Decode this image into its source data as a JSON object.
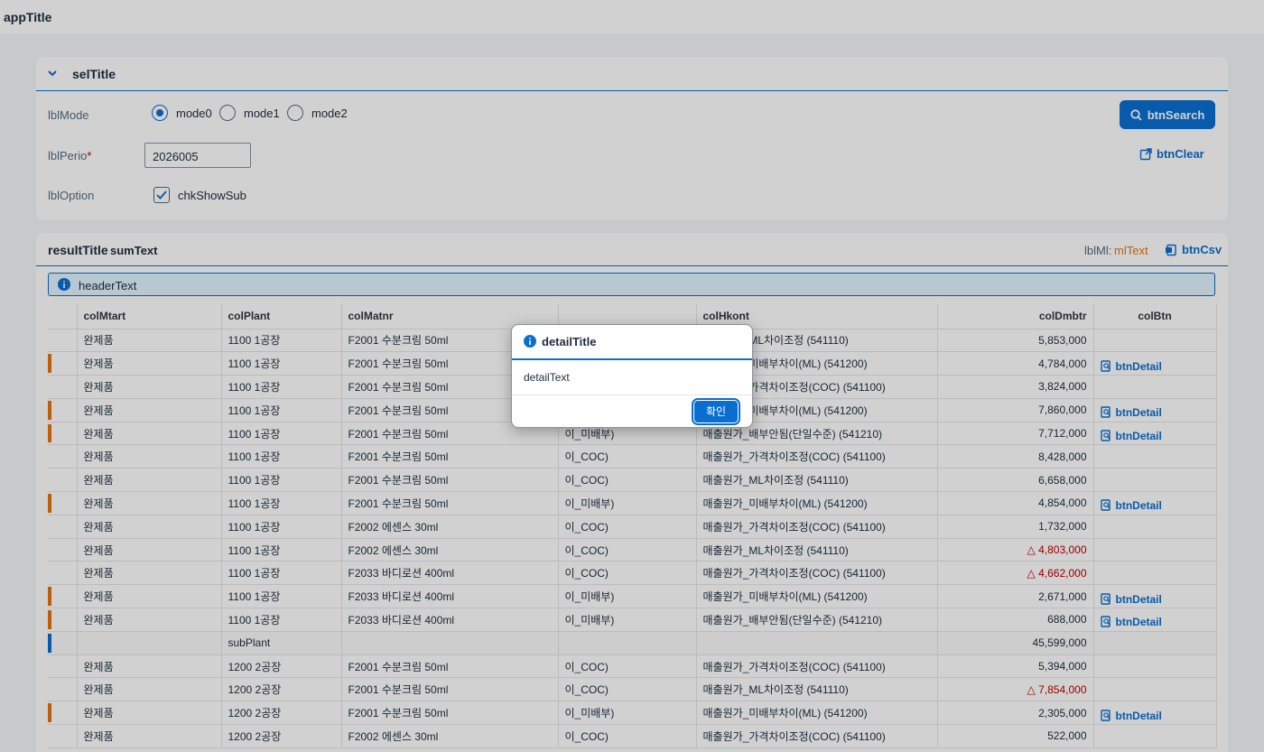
{
  "app": {
    "title": "appTitle"
  },
  "selection": {
    "title": "selTitle",
    "mode_label": "lblMode",
    "modes": [
      "mode0",
      "mode1",
      "mode2"
    ],
    "selected_mode": "mode0",
    "perio_label": "lblPerio",
    "perio_required": "*",
    "perio_value": "2026005",
    "option_label": "lblOption",
    "checkbox_label": "chkShowSub",
    "checkbox_checked": true,
    "search_label": "btnSearch",
    "clear_label": "btnClear"
  },
  "results": {
    "title": "resultTitle",
    "sum_text": "sumText",
    "ml_label": "lblMl:",
    "ml_text": "mlText",
    "csv_label": "btnCsv",
    "header_text": "headerText",
    "columns": [
      "",
      "colMtart",
      "colPlant",
      "colMatnr",
      "",
      "colHkont",
      "colDmbtr",
      "colBtn"
    ],
    "rows": [
      {
        "indicator": "",
        "mtart": "완제품",
        "plant": "1100 1공장",
        "matnr": "F2001 수분크림 50ml",
        "diff": "",
        "hkont": "매출원가_ML차이조정 (541110)",
        "dmbtr": "5,853,000",
        "neg": false,
        "btn": ""
      },
      {
        "indicator": "#e9730c",
        "mtart": "완제품",
        "plant": "1100 1공장",
        "matnr": "F2001 수분크림 50ml",
        "diff": "",
        "hkont": "매출원가_미배부차이(ML) (541200)",
        "dmbtr": "4,784,000",
        "neg": false,
        "btn": "btnDetail"
      },
      {
        "indicator": "",
        "mtart": "완제품",
        "plant": "1100 1공장",
        "matnr": "F2001 수분크림 50ml",
        "diff": "",
        "hkont": "매출원가_가격차이조정(COC) (541100)",
        "dmbtr": "3,824,000",
        "neg": false,
        "btn": ""
      },
      {
        "indicator": "#e9730c",
        "mtart": "완제품",
        "plant": "1100 1공장",
        "matnr": "F2001 수분크림 50ml",
        "diff": "",
        "hkont": "매출원가_미배부차이(ML) (541200)",
        "dmbtr": "7,860,000",
        "neg": false,
        "btn": "btnDetail"
      },
      {
        "indicator": "#e9730c",
        "mtart": "완제품",
        "plant": "1100 1공장",
        "matnr": "F2001 수분크림 50ml",
        "diff": "이_미배부)",
        "hkont": "매출원가_배부안됨(단일수준) (541210)",
        "dmbtr": "7,712,000",
        "neg": false,
        "btn": "btnDetail"
      },
      {
        "indicator": "",
        "mtart": "완제품",
        "plant": "1100 1공장",
        "matnr": "F2001 수분크림 50ml",
        "diff": "이_COC)",
        "hkont": "매출원가_가격차이조정(COC) (541100)",
        "dmbtr": "8,428,000",
        "neg": false,
        "btn": ""
      },
      {
        "indicator": "",
        "mtart": "완제품",
        "plant": "1100 1공장",
        "matnr": "F2001 수분크림 50ml",
        "diff": "이_COC)",
        "hkont": "매출원가_ML차이조정 (541110)",
        "dmbtr": "6,658,000",
        "neg": false,
        "btn": ""
      },
      {
        "indicator": "#e9730c",
        "mtart": "완제품",
        "plant": "1100 1공장",
        "matnr": "F2001 수분크림 50ml",
        "diff": "이_미배부)",
        "hkont": "매출원가_미배부차이(ML) (541200)",
        "dmbtr": "4,854,000",
        "neg": false,
        "btn": "btnDetail"
      },
      {
        "indicator": "",
        "mtart": "완제품",
        "plant": "1100 1공장",
        "matnr": "F2002 에센스 30ml",
        "diff": "이_COC)",
        "hkont": "매출원가_가격차이조정(COC) (541100)",
        "dmbtr": "1,732,000",
        "neg": false,
        "btn": ""
      },
      {
        "indicator": "",
        "mtart": "완제품",
        "plant": "1100 1공장",
        "matnr": "F2002 에센스 30ml",
        "diff": "이_COC)",
        "hkont": "매출원가_ML차이조정 (541110)",
        "dmbtr": "△ 4,803,000",
        "neg": true,
        "btn": ""
      },
      {
        "indicator": "",
        "mtart": "완제품",
        "plant": "1100 1공장",
        "matnr": "F2033 바디로션 400ml",
        "diff": "이_COC)",
        "hkont": "매출원가_가격차이조정(COC) (541100)",
        "dmbtr": "△ 4,662,000",
        "neg": true,
        "btn": ""
      },
      {
        "indicator": "#e9730c",
        "mtart": "완제품",
        "plant": "1100 1공장",
        "matnr": "F2033 바디로션 400ml",
        "diff": "이_미배부)",
        "hkont": "매출원가_미배부차이(ML) (541200)",
        "dmbtr": "2,671,000",
        "neg": false,
        "btn": "btnDetail"
      },
      {
        "indicator": "#e9730c",
        "mtart": "완제품",
        "plant": "1100 1공장",
        "matnr": "F2033 바디로션 400ml",
        "diff": "이_미배부)",
        "hkont": "매출원가_배부안됨(단일수준) (541210)",
        "dmbtr": "688,000",
        "neg": false,
        "btn": "btnDetail"
      },
      {
        "indicator": "#0a6ed1",
        "mtart": "",
        "plant": "subPlant",
        "matnr": "",
        "diff": "",
        "hkont": "",
        "dmbtr": "45,599,000",
        "neg": false,
        "btn": "",
        "subtotal": true
      },
      {
        "indicator": "",
        "mtart": "완제품",
        "plant": "1200 2공장",
        "matnr": "F2001 수분크림 50ml",
        "diff": "이_COC)",
        "hkont": "매출원가_가격차이조정(COC) (541100)",
        "dmbtr": "5,394,000",
        "neg": false,
        "btn": ""
      },
      {
        "indicator": "",
        "mtart": "완제품",
        "plant": "1200 2공장",
        "matnr": "F2001 수분크림 50ml",
        "diff": "이_COC)",
        "hkont": "매출원가_ML차이조정 (541110)",
        "dmbtr": "△ 7,854,000",
        "neg": true,
        "btn": ""
      },
      {
        "indicator": "#e9730c",
        "mtart": "완제품",
        "plant": "1200 2공장",
        "matnr": "F2001 수분크림 50ml",
        "diff": "이_미배부)",
        "hkont": "매출원가_미배부차이(ML) (541200)",
        "dmbtr": "2,305,000",
        "neg": false,
        "btn": "btnDetail"
      },
      {
        "indicator": "",
        "mtart": "완제품",
        "plant": "1200 2공장",
        "matnr": "F2002 에센스 30ml",
        "diff": "이_COC)",
        "hkont": "매출원가_가격차이조정(COC) (541100)",
        "dmbtr": "522,000",
        "neg": false,
        "btn": ""
      }
    ]
  },
  "dialog": {
    "title": "detailTitle",
    "text": "detailText",
    "ok_label": "확인"
  }
}
